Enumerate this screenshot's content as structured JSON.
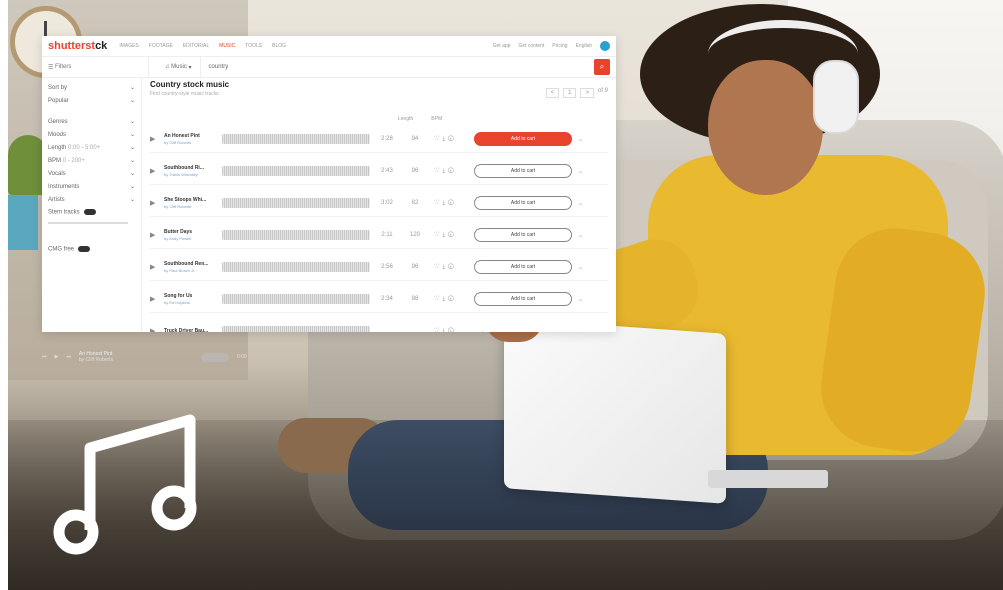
{
  "app": {
    "logo_main": "shutterst",
    "logo_accent": "ck"
  },
  "nav": [
    "IMAGES",
    "FOOTAGE",
    "EDITORIAL",
    "MUSIC",
    "TOOLS",
    "BLOG"
  ],
  "topright": [
    "Get app",
    "Get content",
    "Pricing",
    "English"
  ],
  "search": {
    "filters_label": "Filters",
    "type_label": "Music",
    "query": "country"
  },
  "sidebar": {
    "sort_label": "Sort by",
    "sort_value": "Popular",
    "items": [
      "Genres",
      "Moods",
      "Length",
      "BPM",
      "Vocals",
      "Instruments",
      "Artists"
    ],
    "length_value": "0:00 - 5:00+",
    "bpm_value": "0 - 200+",
    "stem_label": "Stem tracks",
    "cm_label": "CMG free"
  },
  "content": {
    "title": "Country stock music",
    "subtitle": "Find country-style music tracks",
    "pager": [
      "<",
      "1",
      ">",
      "of 9"
    ],
    "col_length": "Length",
    "col_bpm": "BPM"
  },
  "tracks": [
    {
      "title": "An Honest Pint",
      "artist": "by Cliff Roberts",
      "duration": "2:28",
      "bpm": "94",
      "cart": "Add to cart"
    },
    {
      "title": "Southbound Ri...",
      "artist": "by Travis Wheatley",
      "duration": "2:43",
      "bpm": "96",
      "cart": "Add to cart"
    },
    {
      "title": "She Stoops Whi...",
      "artist": "by Cliff Roberts",
      "duration": "3:02",
      "bpm": "82",
      "cart": "Add to cart"
    },
    {
      "title": "Butter Days",
      "artist": "by Andy Powell",
      "duration": "2:11",
      "bpm": "120",
      "cart": "Add to cart"
    },
    {
      "title": "Southbound Ren...",
      "artist": "by Paul Brown Jr.",
      "duration": "2:56",
      "bpm": "96",
      "cart": "Add to cart"
    },
    {
      "title": "Song for Us",
      "artist": "by Ed Hopkins",
      "duration": "2:34",
      "bpm": "88",
      "cart": "Add to cart"
    },
    {
      "title": "Truck Driver Bau...",
      "artist": "",
      "duration": "",
      "bpm": "",
      "cart": ""
    }
  ],
  "player": {
    "title": "An Honest Pint",
    "artist": "by Cliff Roberts",
    "time": "0:00"
  },
  "colors": {
    "accent": "#e8432c",
    "sweater": "#e9b92f"
  },
  "icons": {
    "music": "music-note-icon"
  }
}
